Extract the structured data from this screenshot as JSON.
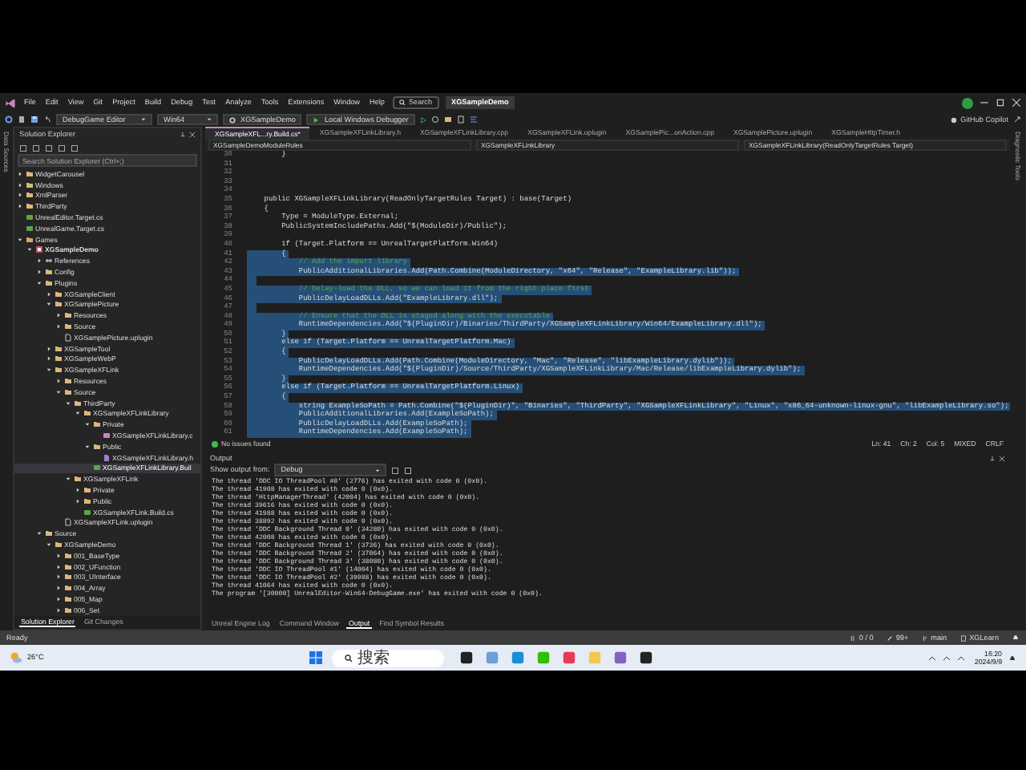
{
  "window": {
    "title": "XGSampleDemo"
  },
  "menu": [
    "File",
    "Edit",
    "View",
    "Git",
    "Project",
    "Build",
    "Debug",
    "Test",
    "Analyze",
    "Tools",
    "Extensions",
    "Window",
    "Help"
  ],
  "search": {
    "label": "Search"
  },
  "toolbar": {
    "configuration": "DebugGame Editor",
    "platform": "Win64",
    "startup_project": "XGSampleDemo",
    "debugger": "Local Windows Debugger",
    "copilot": "GitHub Copilot"
  },
  "left_strip": {
    "label": "Data Sources"
  },
  "right_strip": {
    "label": "Diagnostic Tools"
  },
  "solution_explorer": {
    "title": "Solution Explorer",
    "search_placeholder": "Search Solution Explorer (Ctrl+;)",
    "tree": [
      {
        "label": "WidgetCarousel",
        "kind": "folder",
        "expanded": false,
        "selected": false
      },
      {
        "label": "Windows",
        "kind": "folder",
        "expanded": false,
        "selected": false
      },
      {
        "label": "XmlParser",
        "kind": "folder",
        "expanded": false,
        "selected": false
      },
      {
        "label": "ThirdParty",
        "kind": "folder",
        "expanded": false,
        "selected": false
      },
      {
        "label": "UnrealEditor.Target.cs",
        "kind": "cs",
        "selected": false
      },
      {
        "label": "UnrealGame.Target.cs",
        "kind": "cs",
        "selected": false
      },
      {
        "label": "Games",
        "kind": "solution_folder",
        "selected": false,
        "expanded": true,
        "children": [
          {
            "label": "XGSampleDemo",
            "kind": "project",
            "expanded": true,
            "selected": false,
            "children": [
              {
                "label": "References",
                "kind": "references",
                "expanded": false,
                "selected": false
              },
              {
                "label": "Config",
                "kind": "folder",
                "expanded": false,
                "selected": false
              },
              {
                "label": "Plugins",
                "kind": "folder",
                "expanded": true,
                "selected": false,
                "children": [
                  {
                    "label": "XGSampleClient",
                    "kind": "folder",
                    "expanded": false,
                    "selected": false
                  },
                  {
                    "label": "XGSamplePicture",
                    "kind": "folder",
                    "expanded": true,
                    "selected": false,
                    "children": [
                      {
                        "label": "Resources",
                        "kind": "folder",
                        "expanded": false,
                        "selected": false
                      },
                      {
                        "label": "Source",
                        "kind": "folder",
                        "expanded": false,
                        "selected": false
                      },
                      {
                        "label": "XGSamplePicture.uplugin",
                        "kind": "file",
                        "selected": false
                      }
                    ]
                  },
                  {
                    "label": "XGSampleTool",
                    "kind": "folder",
                    "expanded": false,
                    "selected": false
                  },
                  {
                    "label": "XGSampleWebP",
                    "kind": "folder",
                    "expanded": false,
                    "selected": false
                  },
                  {
                    "label": "XGSampleXFLink",
                    "kind": "folder",
                    "expanded": true,
                    "selected": false,
                    "children": [
                      {
                        "label": "Resources",
                        "kind": "folder",
                        "expanded": false,
                        "selected": false
                      },
                      {
                        "label": "Source",
                        "kind": "folder",
                        "expanded": true,
                        "selected": false,
                        "children": [
                          {
                            "label": "ThirdParty",
                            "kind": "folder",
                            "expanded": true,
                            "selected": false,
                            "children": [
                              {
                                "label": "XGSampleXFLinkLibrary",
                                "kind": "folder",
                                "expanded": true,
                                "selected": false,
                                "children": [
                                  {
                                    "label": "Private",
                                    "kind": "folder",
                                    "expanded": true,
                                    "selected": false,
                                    "children": [
                                      {
                                        "label": "XGSampleXFLinkLibrary.c",
                                        "kind": "cpp",
                                        "selected": false
                                      }
                                    ]
                                  },
                                  {
                                    "label": "Public",
                                    "kind": "folder",
                                    "expanded": true,
                                    "selected": false,
                                    "children": [
                                      {
                                        "label": "XGSampleXFLinkLibrary.h",
                                        "kind": "header",
                                        "selected": false
                                      }
                                    ]
                                  },
                                  {
                                    "label": "XGSampleXFLinkLibrary.Buil",
                                    "kind": "cs",
                                    "selected": true
                                  }
                                ]
                              }
                            ]
                          },
                          {
                            "label": "XGSampleXFLink",
                            "kind": "folder",
                            "expanded": true,
                            "selected": false,
                            "children": [
                              {
                                "label": "Private",
                                "kind": "folder",
                                "expanded": false,
                                "selected": false
                              },
                              {
                                "label": "Public",
                                "kind": "folder",
                                "expanded": false,
                                "selected": false
                              },
                              {
                                "label": "XGSampleXFLink.Build.cs",
                                "kind": "cs",
                                "selected": false
                              }
                            ]
                          }
                        ]
                      },
                      {
                        "label": "XGSampleXFLink.uplugin",
                        "kind": "file",
                        "selected": false
                      }
                    ]
                  }
                ]
              },
              {
                "label": "Source",
                "kind": "folder",
                "expanded": true,
                "selected": false,
                "children": [
                  {
                    "label": "XGSampleDemo",
                    "kind": "folder",
                    "expanded": true,
                    "selected": false,
                    "children": [
                      {
                        "label": "001_BaseType",
                        "kind": "folder",
                        "expanded": false,
                        "selected": false
                      },
                      {
                        "label": "002_UFunction",
                        "kind": "folder",
                        "expanded": false,
                        "selected": false
                      },
                      {
                        "label": "003_UInterface",
                        "kind": "folder",
                        "expanded": false,
                        "selected": false
                      },
                      {
                        "label": "004_Array",
                        "kind": "folder",
                        "expanded": false,
                        "selected": false
                      },
                      {
                        "label": "005_Map",
                        "kind": "folder",
                        "expanded": false,
                        "selected": false
                      },
                      {
                        "label": "006_Set",
                        "kind": "folder",
                        "expanded": false,
                        "selected": false
                      }
                    ]
                  }
                ]
              }
            ]
          }
        ]
      }
    ],
    "tabs": [
      {
        "label": "Solution Explorer",
        "selected": true
      },
      {
        "label": "Git Changes",
        "selected": false
      }
    ]
  },
  "editor": {
    "tabs": [
      {
        "label": "XGSampleXFL...ry.Build.cs*",
        "selected": true
      },
      {
        "label": "XGSampleXFLinkLibrary.h",
        "selected": false
      },
      {
        "label": "XGSampleXFLinkLibrary.cpp",
        "selected": false
      },
      {
        "label": "XGSampleXFLink.uplugin",
        "selected": false
      },
      {
        "label": "XGSamplePic...onAction.cpp",
        "selected": false
      },
      {
        "label": "XGSamplePicture.uplugin",
        "selected": false
      },
      {
        "label": "XGSampleHttpTimer.h",
        "selected": false
      }
    ],
    "nav": [
      "XGSampleDemoModuleRules",
      "XGSampleXFLinkLibrary",
      "XGSampleXFLinkLibrary(ReadOnlyTargetRules Target)"
    ],
    "lines": [
      {
        "number": "30",
        "text": "        }",
        "kind": "code",
        "selected": false
      },
      {
        "number": "31",
        "kind": "code",
        "selected": false
      },
      {
        "number": "32",
        "kind": "code",
        "selected": false
      },
      {
        "number": "33",
        "kind": "code",
        "selected": false
      },
      {
        "number": "34",
        "kind": "code",
        "selected": false
      },
      {
        "number": "35",
        "text": "    public XGSampleXFLinkLibrary(ReadOnlyTargetRules Target) : base(Target)",
        "kind": "code",
        "selected": false
      },
      {
        "number": "36",
        "text": "    {",
        "kind": "code",
        "selected": false
      },
      {
        "number": "37",
        "text": "        Type = ModuleType.External;",
        "kind": "code",
        "selected": false
      },
      {
        "number": "38",
        "text": "        PublicSystemIncludePaths.Add(\"$(ModuleDir)/Public\");",
        "kind": "code",
        "selected": false
      },
      {
        "number": "39",
        "kind": "code",
        "selected": false
      },
      {
        "number": "40",
        "text": "        if (Target.Platform == UnrealTargetPlatform.Win64)",
        "kind": "code",
        "selected": false
      },
      {
        "number": "41",
        "text": "        {",
        "kind": "code",
        "selected": true
      },
      {
        "number": "42",
        "text": "            // Add the import library",
        "kind": "comment",
        "selected": true
      },
      {
        "number": "43",
        "text": "            PublicAdditionalLibraries.Add(Path.Combine(ModuleDirectory, \"x64\", \"Release\", \"ExampleLibrary.lib\"));",
        "kind": "code",
        "selected": true
      },
      {
        "number": "44",
        "kind": "code",
        "selected": true
      },
      {
        "number": "45",
        "text": "            // Delay-load the DLL, so we can load it from the right place first",
        "kind": "comment",
        "selected": true
      },
      {
        "number": "46",
        "text": "            PublicDelayLoadDLLs.Add(\"ExampleLibrary.dll\");",
        "kind": "code",
        "selected": true
      },
      {
        "number": "47",
        "kind": "code",
        "selected": true
      },
      {
        "number": "48",
        "text": "            // Ensure that the DLL is staged along with the executable",
        "kind": "comment",
        "selected": true
      },
      {
        "number": "49",
        "text": "            RuntimeDependencies.Add(\"$(PluginDir)/Binaries/ThirdParty/XGSampleXFLinkLibrary/Win64/ExampleLibrary.dll\");",
        "kind": "code",
        "selected": true
      },
      {
        "number": "50",
        "text": "        }",
        "kind": "code",
        "selected": true
      },
      {
        "number": "51",
        "text": "        else if (Target.Platform == UnrealTargetPlatform.Mac)",
        "kind": "code",
        "selected": true
      },
      {
        "number": "52",
        "text": "        {",
        "kind": "code",
        "selected": true
      },
      {
        "number": "53",
        "text": "            PublicDelayLoadDLLs.Add(Path.Combine(ModuleDirectory, \"Mac\", \"Release\", \"libExampleLibrary.dylib\"));",
        "kind": "code",
        "selected": true
      },
      {
        "number": "54",
        "text": "            RuntimeDependencies.Add(\"$(PluginDir)/Source/ThirdParty/XGSampleXFLinkLibrary/Mac/Release/libExampleLibrary.dylib\");",
        "kind": "code",
        "selected": true
      },
      {
        "number": "55",
        "text": "        }",
        "kind": "code",
        "selected": true
      },
      {
        "number": "56",
        "text": "        else if (Target.Platform == UnrealTargetPlatform.Linux)",
        "kind": "code",
        "selected": true
      },
      {
        "number": "57",
        "text": "        {",
        "kind": "code",
        "selected": true
      },
      {
        "number": "58",
        "text": "            string ExampleSoPath = Path.Combine(\"$(PluginDir)\", \"Binaries\", \"ThirdParty\", \"XGSampleXFLinkLibrary\", \"Linux\", \"x86_64-unknown-linux-gnu\", \"libExampleLibrary.so\");",
        "kind": "code",
        "selected": true
      },
      {
        "number": "59",
        "text": "            PublicAdditionalLibraries.Add(ExampleSoPath);",
        "kind": "code",
        "selected": true
      },
      {
        "number": "60",
        "text": "            PublicDelayLoadDLLs.Add(ExampleSoPath);",
        "kind": "code",
        "selected": true
      },
      {
        "number": "61",
        "text": "            RuntimeDependencies.Add(ExampleSoPath);",
        "kind": "code",
        "selected": true
      }
    ],
    "status": {
      "issues": "No issues found",
      "line": "Ln: 41",
      "char": "Ch: 2",
      "column": "Col: 5",
      "indent": "MIXED",
      "line_ending": "CRLF"
    }
  },
  "output": {
    "title": "Output",
    "source_label": "Show output from:",
    "source": "Debug",
    "lines": [
      "The thread 'DDC IO ThreadPool #0' (2776) has exited with code 0 (0x0).",
      "The thread 41908 has exited with code 0 (0x0).",
      "The thread 'HttpManagerThread' (42004) has exited with code 0 (0x0).",
      "The thread 39616 has exited with code 0 (0x0).",
      "The thread 41988 has exited with code 0 (0x0).",
      "The thread 38892 has exited with code 0 (0x0).",
      "The thread 'DDC Background Thread 0' (34280) has exited with code 0 (0x0).",
      "The thread 42008 has exited with code 0 (0x0).",
      "The thread 'DDC Background Thread 1' (3736) has exited with code 0 (0x0).",
      "The thread 'DDC Background Thread 2' (37064) has exited with code 0 (0x0).",
      "The thread 'DDC Background Thread 3' (38080) has exited with code 0 (0x0).",
      "The thread 'DDC IO ThreadPool #1' (14004) has exited with code 0 (0x0).",
      "The thread 'DDC IO ThreadPool #2' (39988) has exited with code 0 (0x0).",
      "The thread 41064 has exited with code 0 (0x0).",
      "The program '[30000] UnrealEditor-Win64-DebugGame.exe' has exited with code 0 (0x0)."
    ],
    "tabs": [
      {
        "label": "Unreal Engine Log",
        "selected": false
      },
      {
        "label": "Command Window",
        "selected": false
      },
      {
        "label": "Output",
        "selected": true
      },
      {
        "label": "Find Symbol Results",
        "selected": false
      }
    ]
  },
  "status_bar": {
    "text": "Ready",
    "sync": "0 / 0",
    "edits": "99+",
    "branch": "main",
    "repository": "XGLearn"
  },
  "taskbar": {
    "weather": "26°C",
    "search": "搜索",
    "time": "16:20",
    "date": "2024/9/9"
  }
}
